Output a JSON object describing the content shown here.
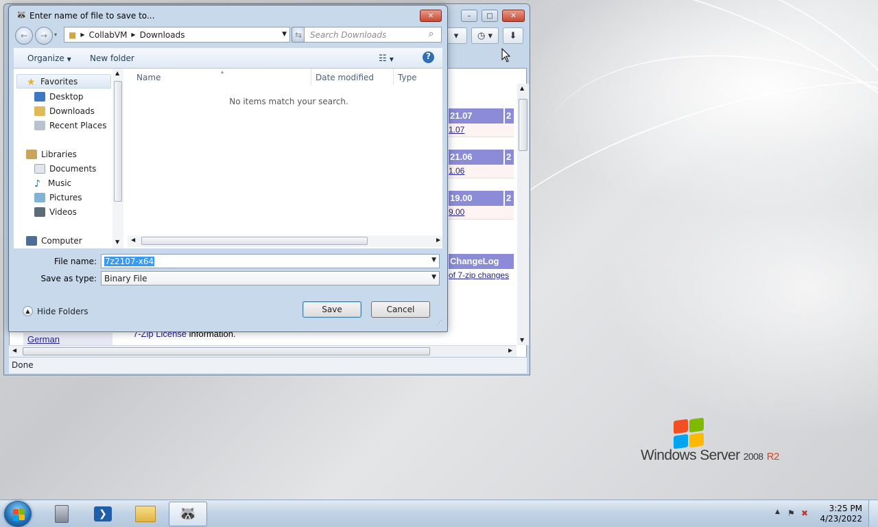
{
  "dialog": {
    "title": "Enter name of file to save to...",
    "address": {
      "segments": [
        "CollabVM",
        "Downloads"
      ]
    },
    "search_placeholder": "Search Downloads",
    "toolbar": {
      "organize": "Organize",
      "new_folder": "New folder"
    },
    "nav": {
      "favorites_header": "Favorites",
      "favorites": [
        "Desktop",
        "Downloads",
        "Recent Places"
      ],
      "libraries_header": "Libraries",
      "libraries": [
        "Documents",
        "Music",
        "Pictures",
        "Videos"
      ],
      "computer": "Computer"
    },
    "columns": [
      "Name",
      "Date modified",
      "Type"
    ],
    "empty_message": "No items match your search.",
    "file_name_label": "File name:",
    "file_name_value": "7z2107-x64",
    "save_as_type_label": "Save as type:",
    "save_as_type_value": "Binary File",
    "save_button": "Save",
    "cancel_button": "Cancel",
    "hide_folders": "Hide Folders"
  },
  "browser": {
    "versions": [
      {
        "header": "21.07",
        "link": "1.07",
        "tail": "2"
      },
      {
        "header": "21.06",
        "link": "1.06",
        "tail": "2"
      },
      {
        "header": "19.00",
        "link": "9.00",
        "tail": "2"
      }
    ],
    "changelog_header": "ChangeLog",
    "changelog_link": "of 7-zip changes",
    "sidebar_language": "German",
    "license_link": "7-Zip License",
    "license_text": " information.",
    "status": "Done"
  },
  "desktop": {
    "brand_main": "Windows Server",
    "brand_version": "2008",
    "brand_release": "R2"
  },
  "taskbar": {
    "time": "3:25 PM",
    "date": "4/23/2022"
  },
  "colors": {
    "version_header_bg": "#8b8bd8",
    "link_color": "#20209a",
    "selection_bg": "#3399ff"
  }
}
